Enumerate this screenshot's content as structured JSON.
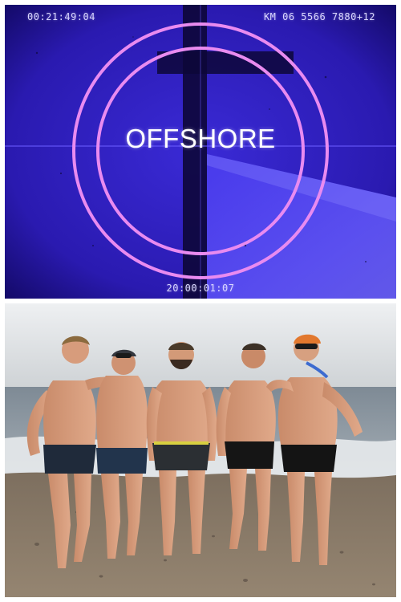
{
  "title_card": {
    "title": "OFFSHORE",
    "timecode_top_left": "00:21:49:04",
    "counter_top_right": "KM 06 5566 7880+12",
    "timecode_bottom": "20:00:01:07"
  },
  "photo": {
    "subject": "Five men in swimming trunks posing on a pebble beach at the water's edge",
    "person_count": 5
  },
  "colors": {
    "title_card_background": "#23169a",
    "leader_circles": "#e98bf0",
    "title_text": "#ffffff",
    "sky": "#d6d8db",
    "sea": "#8f9aa4",
    "sand": "#8a7a66"
  }
}
